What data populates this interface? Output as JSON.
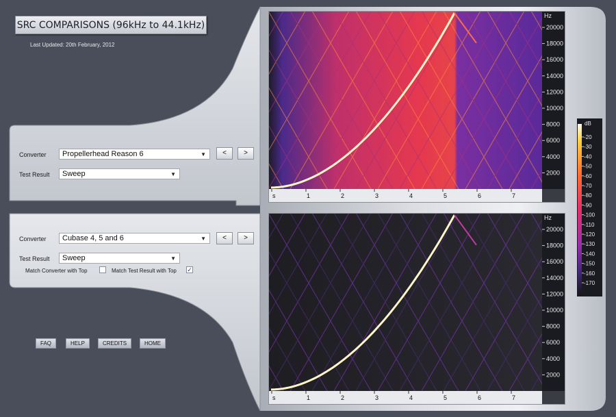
{
  "header": {
    "title": "SRC COMPARISONS (96kHz to 44.1kHz)",
    "last_updated": "Last Updated: 20th February, 2012"
  },
  "top_panel": {
    "converter_label": "Converter",
    "converter_value": "Propellerhead Reason 6",
    "test_result_label": "Test Result",
    "test_result_value": "Sweep",
    "prev_label": "<",
    "next_label": ">"
  },
  "bottom_panel": {
    "converter_label": "Converter",
    "converter_value": "Cubase 4, 5 and 6",
    "test_result_label": "Test Result",
    "test_result_value": "Sweep",
    "prev_label": "<",
    "next_label": ">",
    "match_converter_label": "Match Converter with Top",
    "match_converter_checked": false,
    "match_result_label": "Match Test Result with Top",
    "match_result_checked": true
  },
  "footer": {
    "faq": "FAQ",
    "help": "HELP",
    "credits": "CREDITS",
    "home": "HOME"
  },
  "spectrogram": {
    "y_unit": "Hz",
    "y_ticks": [
      "20000",
      "18000",
      "16000",
      "14000",
      "12000",
      "10000",
      "8000",
      "6000",
      "4000",
      "2000"
    ],
    "x_ticks": [
      "s",
      "1",
      "2",
      "3",
      "4",
      "5",
      "6",
      "7"
    ]
  },
  "colorbar": {
    "unit": "dB",
    "ticks": [
      "-20",
      "-30",
      "-40",
      "-50",
      "-60",
      "-70",
      "-80",
      "-90",
      "-100",
      "-110",
      "-120",
      "-130",
      "-140",
      "-150",
      "-160",
      "-170"
    ]
  },
  "colors": {
    "background": "#4a4e5a",
    "panel": "#c9ccd3",
    "sweep": "#fff6c8",
    "top_hot": "#ff5048",
    "bottom_dark": "#26252a"
  },
  "icons": {
    "dropdown": "triangle-down-icon",
    "checkmark": "check-icon"
  }
}
